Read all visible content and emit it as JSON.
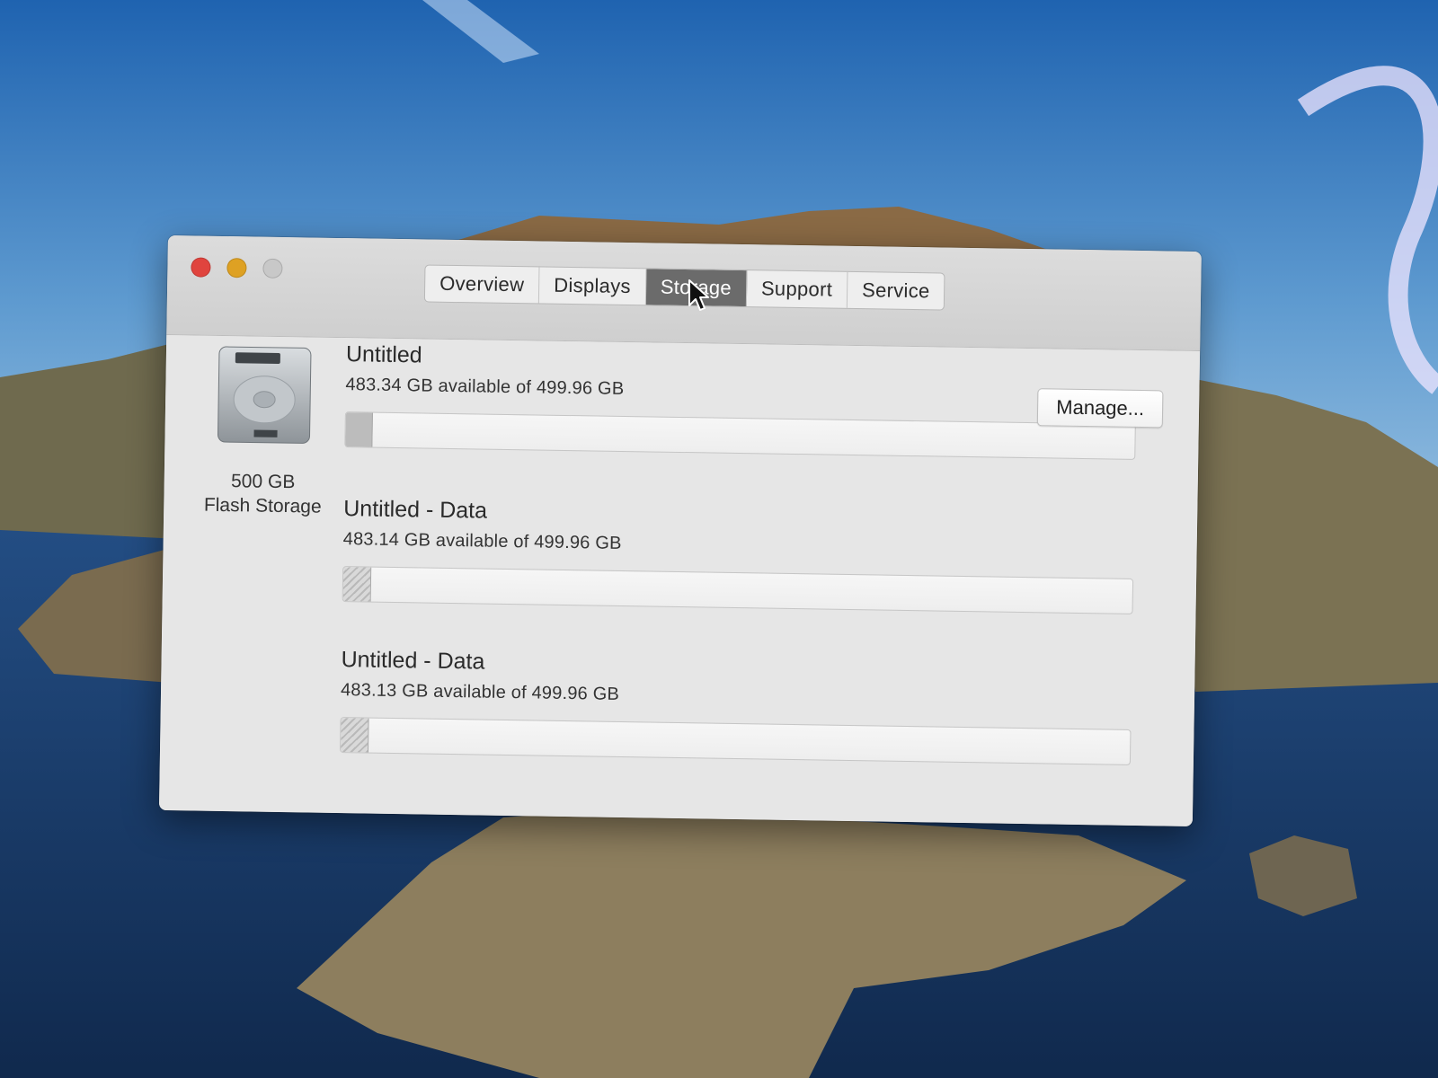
{
  "window": {
    "tabs": [
      {
        "label": "Overview",
        "active": false
      },
      {
        "label": "Displays",
        "active": false
      },
      {
        "label": "Storage",
        "active": true
      },
      {
        "label": "Support",
        "active": false
      },
      {
        "label": "Service",
        "active": false
      }
    ]
  },
  "disk": {
    "icon": "hard-drive-icon",
    "size": "500 GB",
    "type": "Flash Storage"
  },
  "volumes": [
    {
      "name": "Untitled",
      "available": "483.34 GB available of 499.96 GB",
      "used_fraction": 0.033,
      "fill_style": "solid"
    },
    {
      "name": "Untitled - Data",
      "available": "483.14 GB available of 499.96 GB",
      "used_fraction": 0.034,
      "fill_style": "hatched"
    },
    {
      "name": "Untitled - Data",
      "available": "483.13 GB available of 499.96 GB",
      "used_fraction": 0.034,
      "fill_style": "hatched"
    }
  ],
  "buttons": {
    "manage": "Manage..."
  },
  "colors": {
    "close": "#e0443e",
    "minimize": "#dea123",
    "zoom_disabled": "#c8c8c8",
    "active_tab": "#6b6b6b"
  }
}
